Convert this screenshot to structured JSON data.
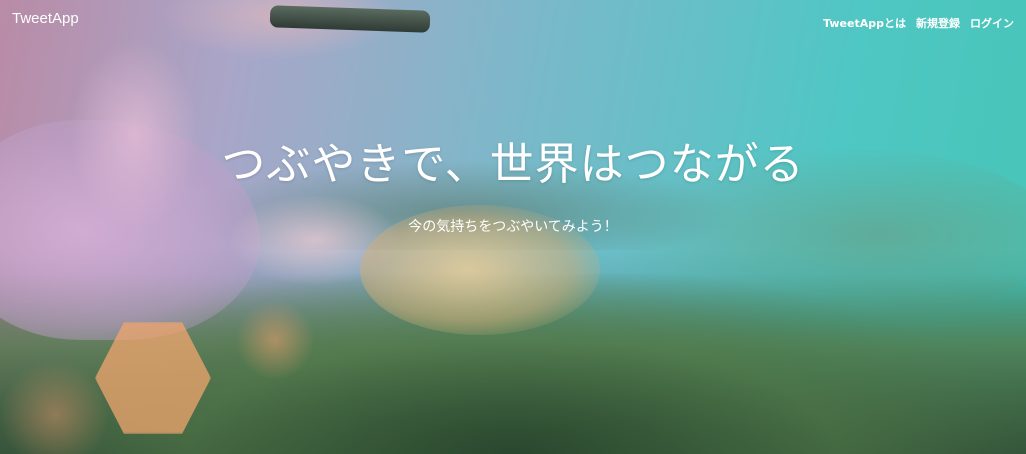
{
  "header": {
    "logo": "TweetApp",
    "nav": [
      {
        "label": "TweetAppとは"
      },
      {
        "label": "新規登録"
      },
      {
        "label": "ログイン"
      }
    ]
  },
  "hero": {
    "title": "つぶやきで、世界はつながる",
    "subtitle": "今の気持ちをつぶやいてみよう！"
  },
  "colors": {
    "gradient_left": "#b98ba6",
    "gradient_right": "#47c4b6",
    "text": "#ffffff",
    "bokeh": "#f0a56e"
  }
}
